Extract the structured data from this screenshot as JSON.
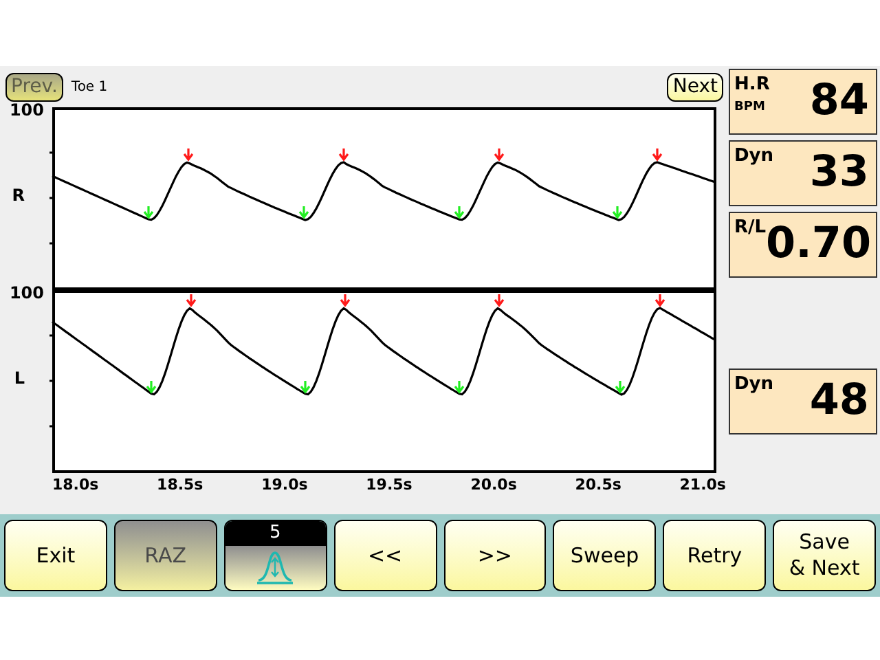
{
  "header": {
    "prev": {
      "label": "Prev.",
      "disabled": true
    },
    "title": "Toe 1",
    "next": {
      "label": "Next",
      "disabled": false
    }
  },
  "plots": [
    {
      "y_max": "100",
      "channel": "R"
    },
    {
      "y_max": "100",
      "channel": "L"
    }
  ],
  "x_axis": [
    "18.0s",
    "18.5s",
    "19.0s",
    "19.5s",
    "20.0s",
    "20.5s",
    "21.0s"
  ],
  "r_readouts": [
    {
      "label": "H.R",
      "unit": "BPM",
      "value": "84"
    },
    {
      "label": "Dyn",
      "value": "33"
    },
    {
      "label": "R/L",
      "value": "0.70"
    }
  ],
  "l_readouts": [
    {
      "label": "Dyn",
      "value": "48"
    }
  ],
  "buttons": [
    {
      "kind": "text",
      "label": "Exit",
      "disabled": false
    },
    {
      "kind": "text",
      "label": "RAZ",
      "disabled": true
    },
    {
      "kind": "filter",
      "label": "5",
      "disabled": false
    },
    {
      "kind": "text",
      "label": "<<",
      "disabled": false
    },
    {
      "kind": "text",
      "label": ">>",
      "disabled": false
    },
    {
      "kind": "text",
      "label": "Sweep",
      "disabled": false
    },
    {
      "kind": "text",
      "label": "Retry",
      "disabled": false
    },
    {
      "kind": "text",
      "label": "Save\n& Next",
      "disabled": false
    }
  ]
}
